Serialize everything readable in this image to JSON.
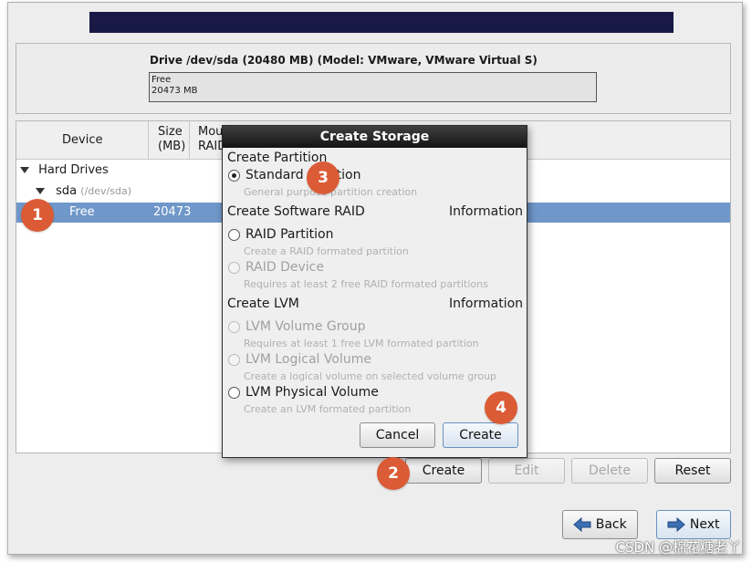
{
  "drive": {
    "title": "Drive /dev/sda (20480 MB) (Model: VMware, VMware Virtual S)",
    "bar_label": "Free",
    "bar_size": "20473 MB"
  },
  "tree": {
    "headers": {
      "device": "Device",
      "size_line1": "Size",
      "size_line2": "(MB)",
      "mount_line1": "Mou",
      "mount_line2": "RAID"
    },
    "hard_drives_label": "Hard Drives",
    "sda_label": "sda",
    "sda_path": "(/dev/sda)",
    "free_label": "Free",
    "free_size": "20473"
  },
  "buttons": {
    "create": "Create",
    "edit": "Edit",
    "delete": "Delete",
    "reset": "Reset",
    "back": "Back",
    "next": "Next"
  },
  "dialog": {
    "title": "Create Storage",
    "section_partition": "Create Partition",
    "standard_partition": "Standard Partition",
    "standard_partition_desc": "General purpose partition creation",
    "section_raid": "Create Software RAID",
    "raid_info": "Information",
    "raid_partition": "RAID Partition",
    "raid_partition_desc": "Create a RAID formated partition",
    "raid_device": "RAID Device",
    "raid_device_desc": "Requires at least 2 free RAID formated partitions",
    "section_lvm": "Create LVM",
    "lvm_info": "Information",
    "lvm_volume_group": "LVM Volume Group",
    "lvm_volume_group_desc": "Requires at least 1 free LVM formated partition",
    "lvm_logical_volume": "LVM Logical Volume",
    "lvm_logical_volume_desc": "Create a logical volume on selected volume group",
    "lvm_physical_volume": "LVM Physical Volume",
    "lvm_physical_volume_desc": "Create an LVM formated partition",
    "cancel": "Cancel",
    "create": "Create"
  },
  "badges": {
    "b1": "1",
    "b2": "2",
    "b3": "3",
    "b4": "4"
  },
  "watermark": "CSDN @棉花糖老丫",
  "colors": {
    "banner": "#181a45",
    "selection": "#6f97c9",
    "badge": "#db5b36"
  }
}
